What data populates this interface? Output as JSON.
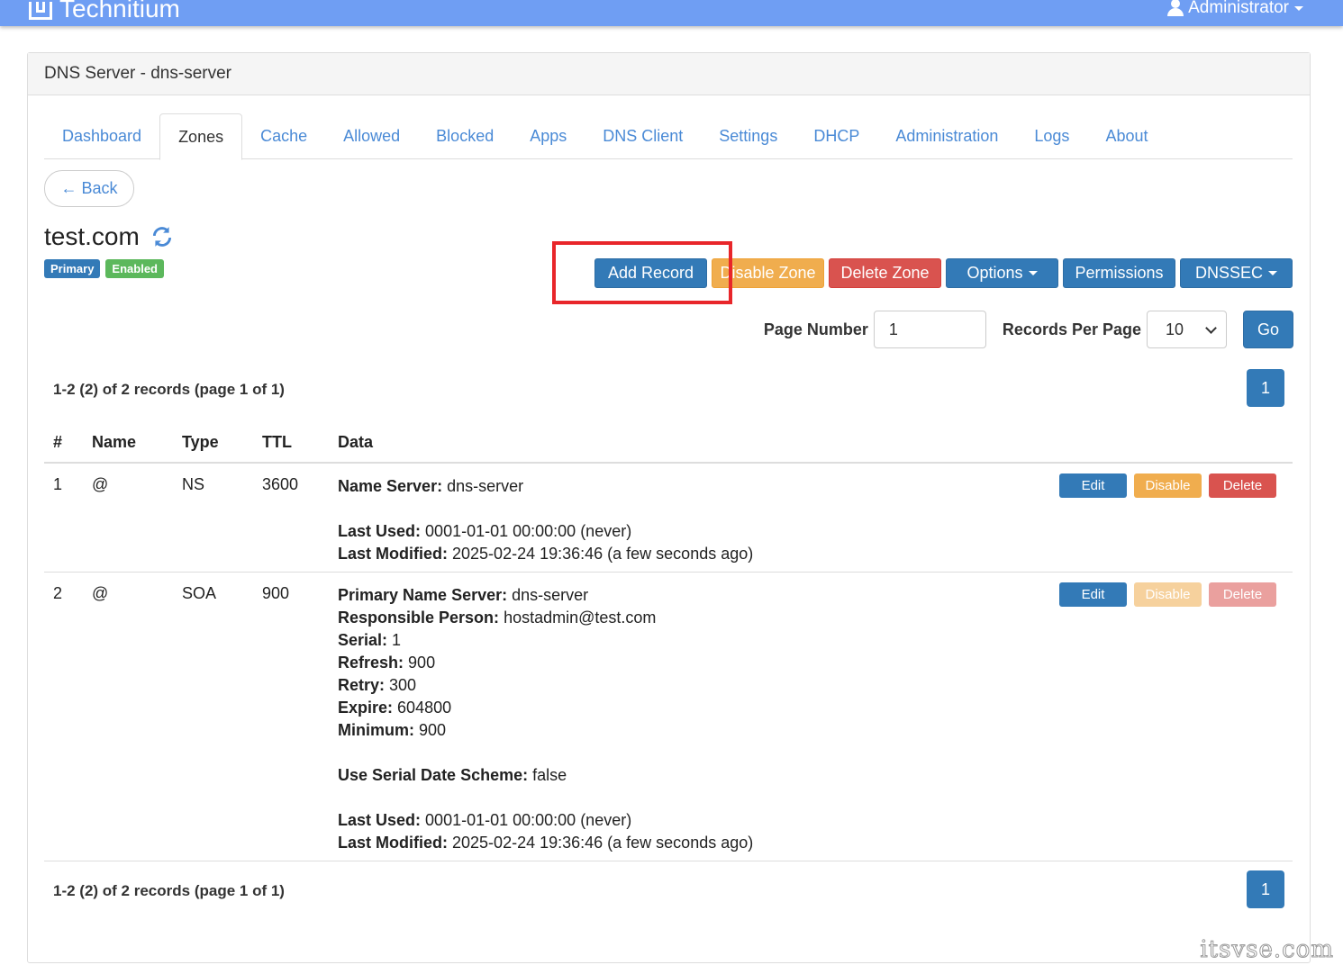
{
  "brand": {
    "name": "Technitium"
  },
  "user": {
    "name": "Administrator"
  },
  "panel": {
    "title": "DNS Server - dns-server"
  },
  "tabs": [
    "Dashboard",
    "Zones",
    "Cache",
    "Allowed",
    "Blocked",
    "Apps",
    "DNS Client",
    "Settings",
    "DHCP",
    "Administration",
    "Logs",
    "About"
  ],
  "active_tab": "Zones",
  "back": {
    "label": "← Back"
  },
  "zone": {
    "name": "test.com",
    "labels": {
      "type": "Primary",
      "status": "Enabled"
    }
  },
  "actions": {
    "add_record": "Add Record",
    "disable_zone": "Disable Zone",
    "delete_zone": "Delete Zone",
    "options": "Options",
    "permissions": "Permissions",
    "dnssec": "DNSSEC"
  },
  "paging": {
    "page_number_label": "Page Number",
    "page_number_value": "1",
    "records_per_page_label": "Records Per Page",
    "records_per_page_value": "10",
    "go": "Go",
    "summary": "1-2 (2) of 2 records (page 1 of 1)",
    "current_page": "1"
  },
  "table": {
    "headers": {
      "num": "#",
      "name": "Name",
      "type": "Type",
      "ttl": "TTL",
      "data": "Data"
    },
    "buttons": {
      "edit": "Edit",
      "disable": "Disable",
      "delete": "Delete"
    },
    "rows": [
      {
        "num": "1",
        "name": "@",
        "type": "NS",
        "ttl": "3600",
        "fields": {
          "ns_label": "Name Server:",
          "ns": "dns-server",
          "used_label": "Last Used:",
          "used": "0001-01-01 00:00:00 (never)",
          "modified_label": "Last Modified:",
          "modified": "2025-02-24 19:36:46 (a few seconds ago)"
        }
      },
      {
        "num": "2",
        "name": "@",
        "type": "SOA",
        "ttl": "900",
        "fields": {
          "pns_label": "Primary Name Server:",
          "pns": "dns-server",
          "rp_label": "Responsible Person:",
          "rp": "hostadmin@test.com",
          "serial_label": "Serial:",
          "serial": "1",
          "refresh_label": "Refresh:",
          "refresh": "900",
          "retry_label": "Retry:",
          "retry": "300",
          "expire_label": "Expire:",
          "expire": "604800",
          "minimum_label": "Minimum:",
          "minimum": "900",
          "scheme_label": "Use Serial Date Scheme:",
          "scheme": "false",
          "used_label": "Last Used:",
          "used": "0001-01-01 00:00:00 (never)",
          "modified_label": "Last Modified:",
          "modified": "2025-02-24 19:36:46 (a few seconds ago)"
        }
      }
    ]
  },
  "watermark": "itsvse.com",
  "colors": {
    "topbar": "#6f9ef3",
    "primary": "#337ab7",
    "warning": "#f0ad4e",
    "danger": "#d9534f",
    "success": "#5cb85c",
    "highlight": "#e8262a"
  }
}
